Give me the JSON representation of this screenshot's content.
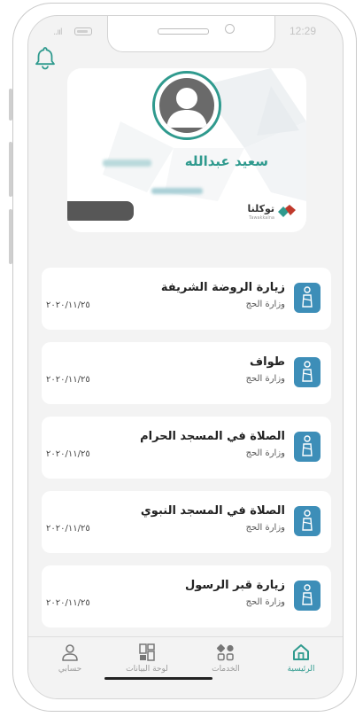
{
  "status": {
    "time": "12:29",
    "signal": "..ııl"
  },
  "card": {
    "name": "سعيد عبدالله",
    "logo_text": "توكلنا",
    "logo_sub": "Tawakkalna"
  },
  "items": [
    {
      "title": "زيارة الروضة الشريفة",
      "subtitle": "وزارة الحج",
      "date": "٢٠٢٠/١١/٢٥",
      "icon": "pilgrim-icon"
    },
    {
      "title": "طواف",
      "subtitle": "وزارة الحج",
      "date": "٢٠٢٠/١١/٢٥",
      "icon": "pilgrim-icon"
    },
    {
      "title": "الصلاة في المسجد الحرام",
      "subtitle": "وزارة الحج",
      "date": "٢٠٢٠/١١/٢٥",
      "icon": "pilgrim-icon"
    },
    {
      "title": "الصلاة في المسجد النبوي",
      "subtitle": "وزارة الحج",
      "date": "٢٠٢٠/١١/٢٥",
      "icon": "pilgrim-icon"
    },
    {
      "title": "زيارة قبر الرسول",
      "subtitle": "وزارة الحج",
      "date": "٢٠٢٠/١١/٢٥",
      "icon": "pilgrim-icon"
    }
  ],
  "tabs": [
    {
      "label": "الرئيسية",
      "icon": "home-icon",
      "active": true
    },
    {
      "label": "الخدمات",
      "icon": "services-icon",
      "active": false
    },
    {
      "label": "لوحة البيانات",
      "icon": "dashboard-icon",
      "active": false
    },
    {
      "label": "حسابي",
      "icon": "user-icon",
      "active": false
    }
  ],
  "colors": {
    "accent": "#2f9a8e",
    "icon_bg": "#3d8eb8",
    "screen_bg": "#f3f3f3"
  }
}
